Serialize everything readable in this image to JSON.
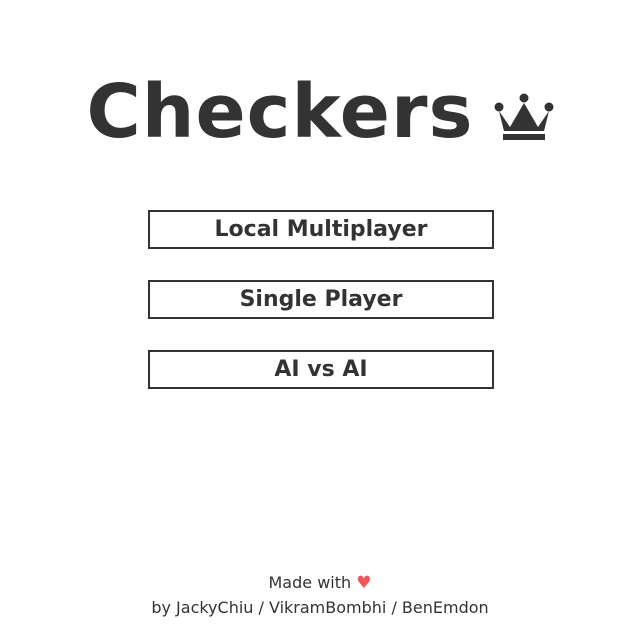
{
  "title": "Checkers",
  "icons": {
    "crown": "crown-icon",
    "heart": "heart-icon"
  },
  "menu": {
    "local_multiplayer": "Local Multiplayer",
    "single_player": "Single Player",
    "ai_vs_ai": "AI vs AI"
  },
  "footer": {
    "made_with": "Made with",
    "heart_glyph": "♥",
    "credits": "by JackyChiu / VikramBombhi / BenEmdon"
  },
  "colors": {
    "text": "#333333",
    "heart": "#f0565b",
    "background": "#ffffff"
  }
}
